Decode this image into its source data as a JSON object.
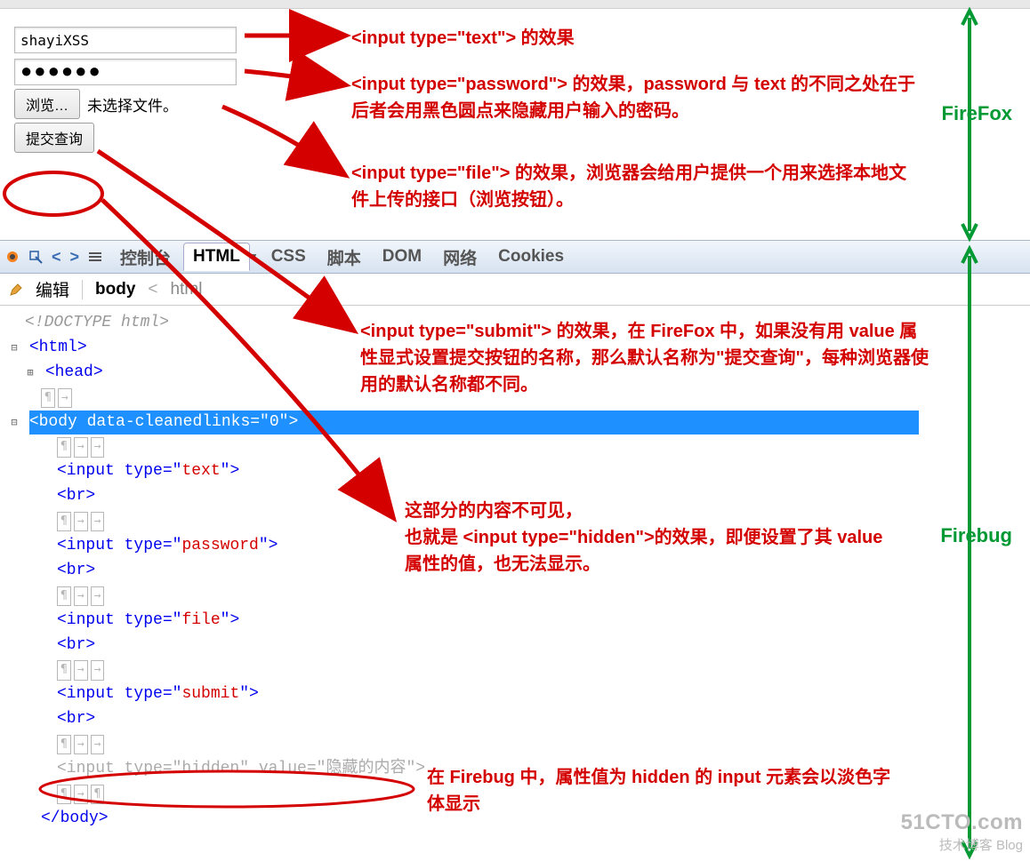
{
  "browser": {
    "text_value": "shayiXSS",
    "password_value": "●●●●●●",
    "file_button": "浏览…",
    "file_status": "未选择文件。",
    "submit_button": "提交查询"
  },
  "annotations": {
    "a1": "<input type=\"text\"> 的效果",
    "a2": "<input type=\"password\"> 的效果，password 与 text 的不同之处在于后者会用黑色圆点来隐藏用户输入的密码。",
    "a3": "<input type=\"file\"> 的效果，浏览器会给用户提供一个用来选择本地文件上传的接口（浏览按钮）。",
    "a4": "<input type=\"submit\"> 的效果，在 FireFox 中，如果没有用 value 属性显式设置提交按钮的名称，那么默认名称为\"提交查询\"，每种浏览器使用的默认名称都不同。",
    "a5": "这部分的内容不可见，\n也就是 <input type=\"hidden\">的效果，即便设置了其 value 属性的值，也无法显示。",
    "a6": "在  Firebug 中，属性值为 hidden 的 input 元素会以淡色字体显示"
  },
  "labels": {
    "firefox": "FireFox",
    "firebug": "Firebug"
  },
  "firebug": {
    "tabs": {
      "console": "控制台",
      "html": "HTML",
      "css": "CSS",
      "script": "脚本",
      "dom": "DOM",
      "net": "网络",
      "cookies": "Cookies"
    },
    "subbar": {
      "edit": "编辑",
      "crumb_body": "body",
      "crumb_html": "html"
    }
  },
  "source": {
    "doctype": "<!DOCTYPE html>",
    "html_open": "<html>",
    "head": "<head>",
    "body_open_pre": "<body data-cleanedlinks=\"",
    "body_open_val": "0",
    "body_open_post": "\">",
    "l_text": "<input type=\"text\">",
    "l_password": "<input type=\"password\">",
    "l_file": "<input type=\"file\">",
    "l_submit": "<input type=\"submit\">",
    "br": "<br>",
    "hidden_pre": "<input type=\"hidden\" value=\"",
    "hidden_val": "隐藏的内容",
    "hidden_post": "\">",
    "body_close": "</body>"
  },
  "watermark": {
    "l1": "51CTO.com",
    "l2": "技术博客  Blog"
  }
}
